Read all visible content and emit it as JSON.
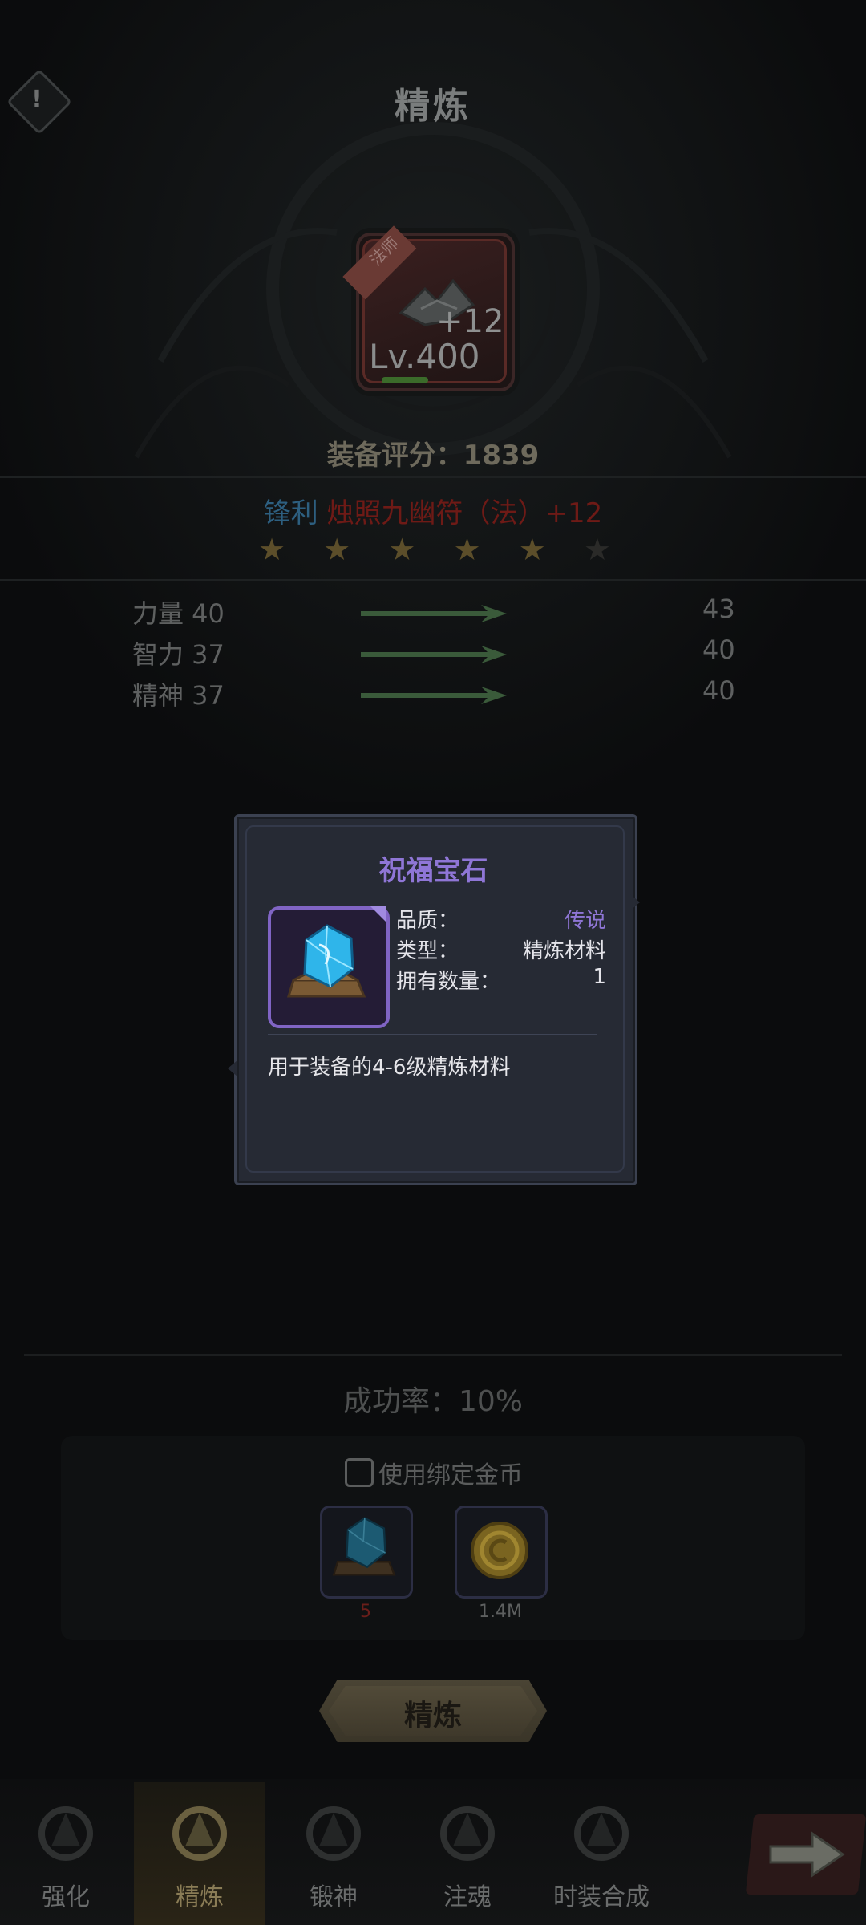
{
  "header": {
    "title": "精炼"
  },
  "equipment": {
    "ribbon": "法师",
    "plus": "+12",
    "level": "Lv.400",
    "score_label": "装备评分：1839",
    "prefix": "锋利",
    "name": "烛照九幽符（法）+12",
    "stars_filled": 5,
    "stars_total": 6
  },
  "stats": [
    {
      "label": "力量 40",
      "new": "43"
    },
    {
      "label": "智力 37",
      "new": "40"
    },
    {
      "label": "精神 37",
      "new": "40"
    }
  ],
  "popup": {
    "title": "祝福宝石",
    "rows": [
      {
        "key": "品质：",
        "value": "传说"
      },
      {
        "key": "类型：",
        "value": "精炼材料"
      },
      {
        "key": "拥有数量：",
        "value": "1"
      }
    ],
    "description": "用于装备的4-6级精炼材料",
    "colors": {
      "title": "#8f76d6",
      "quality": "#8f76d6"
    }
  },
  "refine": {
    "success_rate": "成功率：10%",
    "use_bound_gold": "使用绑定金币",
    "materials": [
      {
        "icon": "blessing-gem-icon",
        "count": "5"
      },
      {
        "icon": "gold-coin-icon",
        "count": "1.4M"
      }
    ],
    "button": "精炼"
  },
  "nav": {
    "tabs": [
      {
        "label": "强化",
        "icon": "enhance-icon"
      },
      {
        "label": "精炼",
        "icon": "refine-icon",
        "active": true
      },
      {
        "label": "锻神",
        "icon": "forge-god-icon"
      },
      {
        "label": "注魂",
        "icon": "soul-inject-icon"
      },
      {
        "label": "时装合成",
        "icon": "fashion-synthesis-icon"
      }
    ],
    "next": "next-arrow-icon"
  }
}
